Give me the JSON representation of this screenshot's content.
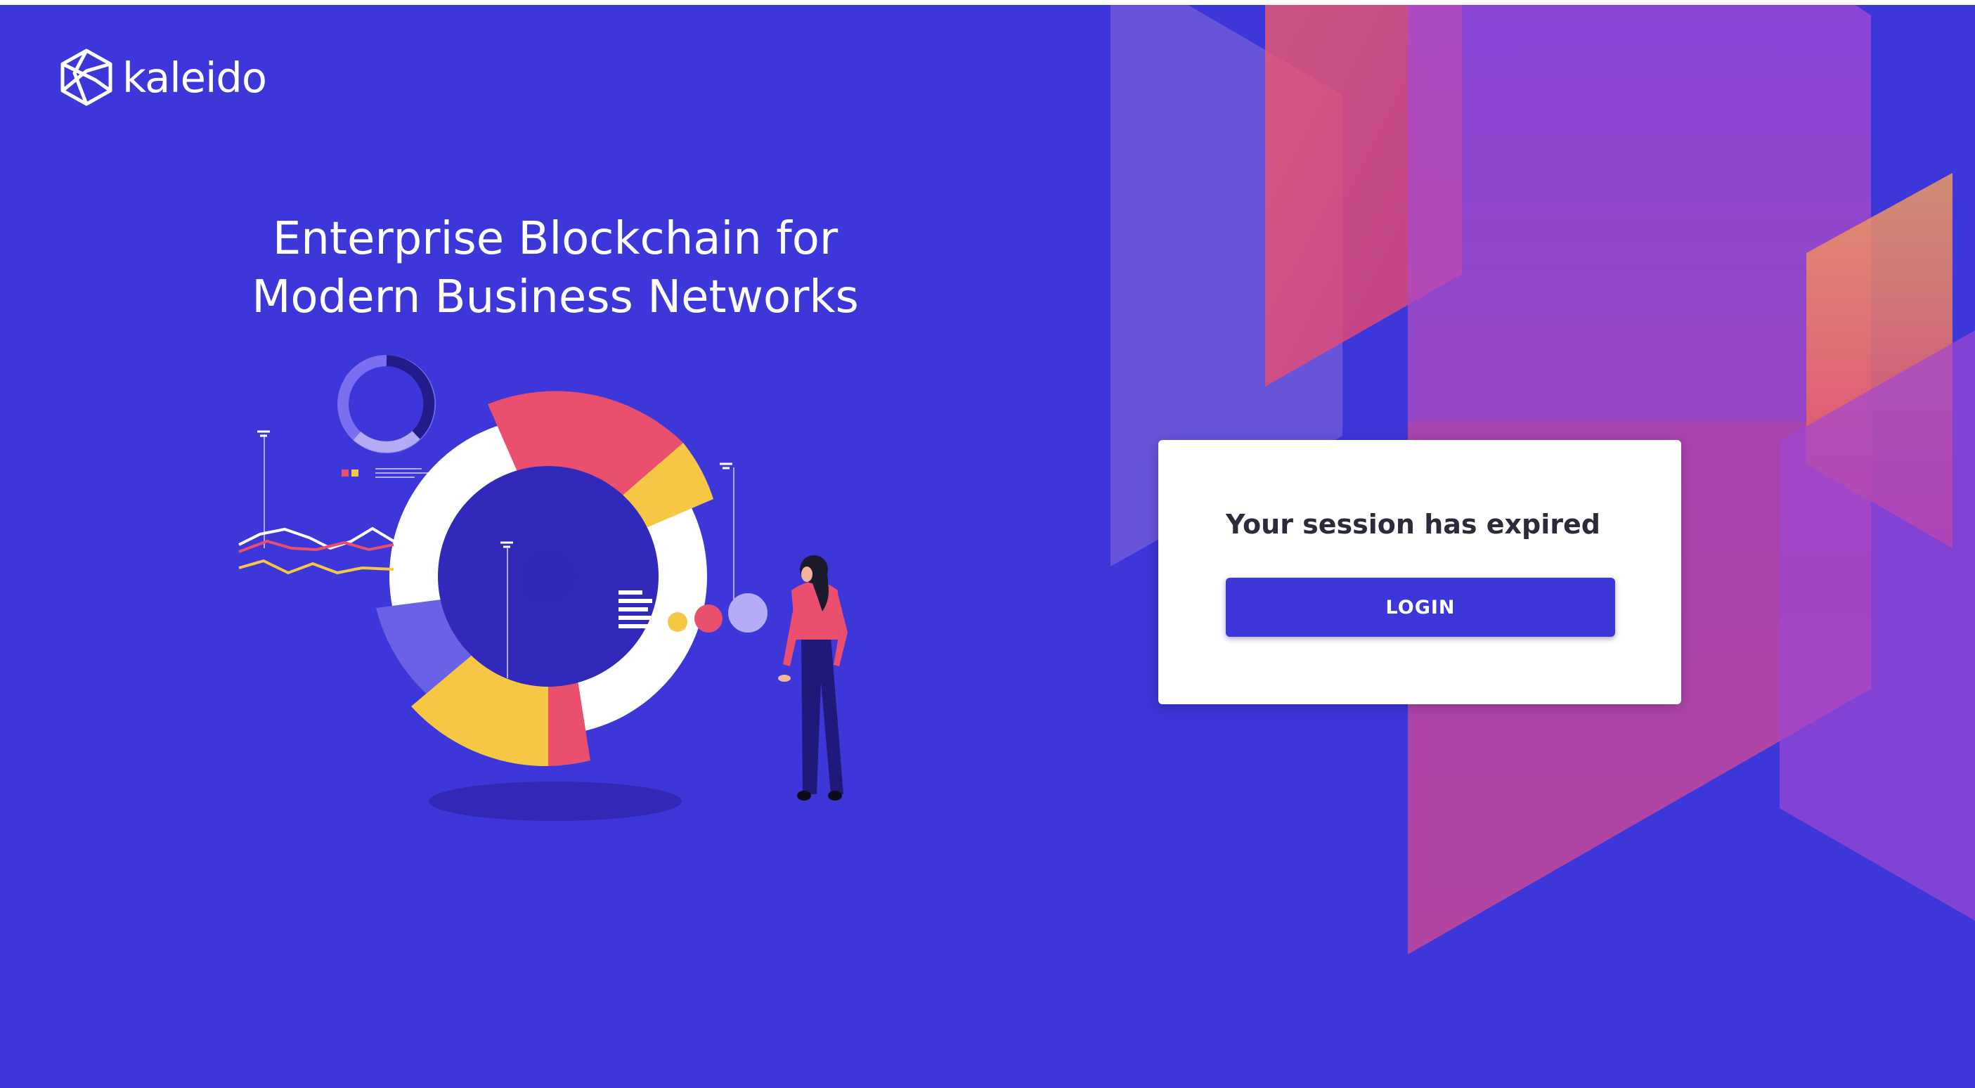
{
  "brand": {
    "name": "kaleido"
  },
  "hero": {
    "line1": "Enterprise Blockchain for",
    "line2": "Modern Business Networks"
  },
  "session": {
    "title": "Your session has expired",
    "login_label": "LOGIN"
  },
  "colors": {
    "background": "#3d36d9",
    "accent_pink": "#ea4f6e",
    "accent_yellow": "#f6c744",
    "accent_lavender": "#6c5ce7",
    "button": "#3d36d9"
  },
  "icons": {
    "logo": "kaleido-hexagon-logo-icon"
  }
}
